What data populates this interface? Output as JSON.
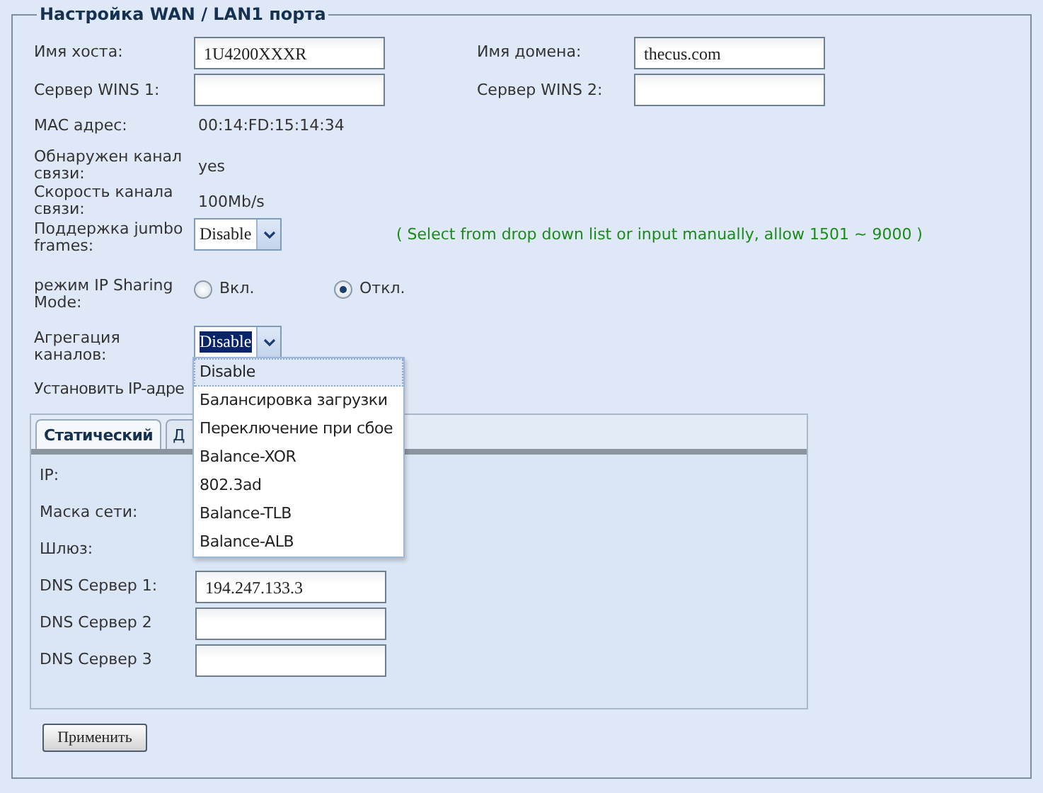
{
  "section": {
    "title": "Настройка WAN / LAN1 порта"
  },
  "host_name": {
    "label": "Имя хоста:",
    "value": "1U4200XXXR"
  },
  "domain_name": {
    "label": "Имя домена:",
    "value": "thecus.com"
  },
  "wins1": {
    "label": "Сервер WINS 1:"
  },
  "wins2": {
    "label": "Сервер WINS 2:"
  },
  "mac": {
    "label": "MAC адрес:",
    "value": "00:14:FD:15:14:34"
  },
  "link_detected": {
    "label": "Обнаружен канал связи:",
    "value": "yes"
  },
  "link_speed": {
    "label": "Скорость канала связи:",
    "value": "100Mb/s"
  },
  "jumbo": {
    "label": "Поддержка jumbo frames:",
    "value": "Disable",
    "hint": "( Select from drop down list or input manually, allow 1501 ~ 9000 )"
  },
  "ip_sharing": {
    "label": "режим IP Sharing Mode:",
    "options": [
      {
        "label": "Вкл.",
        "selected": false
      },
      {
        "label": "Откл.",
        "selected": true
      }
    ]
  },
  "aggregation": {
    "label": "Агрегация каналов:",
    "value": "Disable",
    "expanded": true,
    "options": [
      {
        "label": "Disable",
        "selected": true
      },
      {
        "label": "Балансировка загрузки",
        "selected": false
      },
      {
        "label": "Переключение при сбое",
        "selected": false
      },
      {
        "label": "Balance-XOR",
        "selected": false
      },
      {
        "label": "802.3ad",
        "selected": false
      },
      {
        "label": "Balance-TLB",
        "selected": false
      },
      {
        "label": "Balance-ALB",
        "selected": false
      }
    ]
  },
  "ip_mode_label": "Установить IP-адре",
  "tabs": [
    {
      "label": "Статический",
      "selected": true
    },
    {
      "label": "Д",
      "selected": false
    }
  ],
  "static_fields": [
    {
      "kind": "label_only",
      "label": "IP:"
    },
    {
      "kind": "label_only",
      "label": "Маска сети:"
    },
    {
      "kind": "label_only",
      "label": "Шлюз:"
    },
    {
      "kind": "input",
      "label": "DNS Сервер 1:",
      "value": "194.247.133.3"
    },
    {
      "kind": "input",
      "label": "DNS Сервер 2"
    },
    {
      "kind": "input",
      "label": "DNS Сервер 3"
    }
  ],
  "apply_button": "Применить"
}
